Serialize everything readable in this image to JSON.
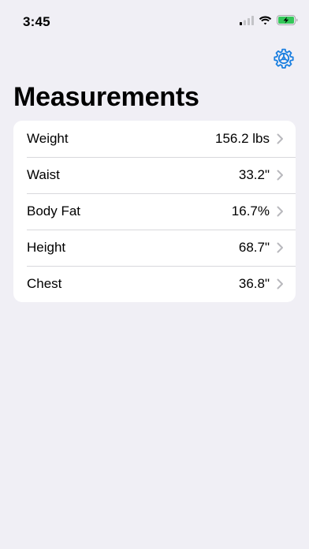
{
  "status_bar": {
    "time": "3:45"
  },
  "header": {
    "title": "Measurements",
    "settings_icon": "gear-icon"
  },
  "colors": {
    "accent": "#1a7fe0",
    "background": "#f0eff5",
    "battery_green": "#34c759",
    "chevron": "#b8b8bd"
  },
  "measurements": [
    {
      "label": "Weight",
      "value": "156.2 lbs"
    },
    {
      "label": "Waist",
      "value": "33.2\""
    },
    {
      "label": "Body Fat",
      "value": "16.7%"
    },
    {
      "label": "Height",
      "value": "68.7\""
    },
    {
      "label": "Chest",
      "value": "36.8\""
    }
  ]
}
